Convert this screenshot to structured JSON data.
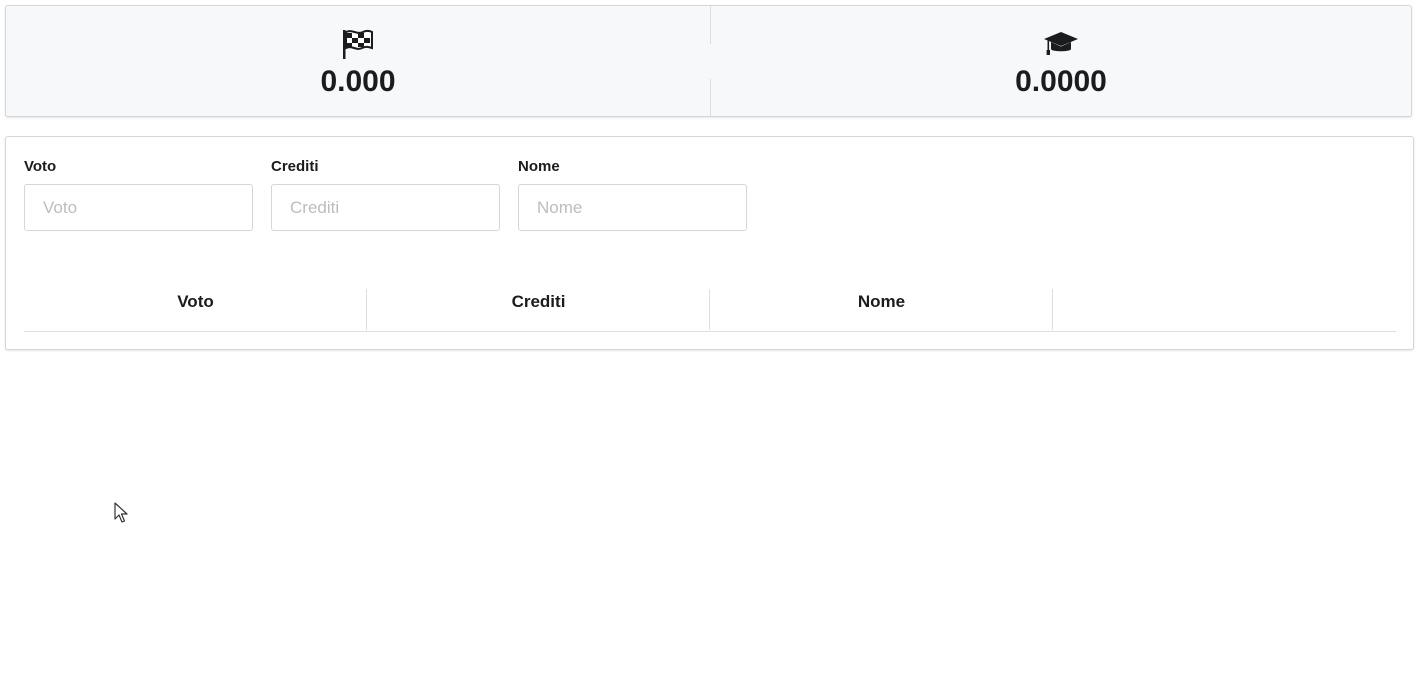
{
  "stats": {
    "left": {
      "icon": "checkered-flag-icon",
      "value": "0.000"
    },
    "right": {
      "icon": "graduation-cap-icon",
      "value": "0.0000"
    }
  },
  "form": {
    "fields": [
      {
        "label": "Voto",
        "placeholder": "Voto",
        "value": ""
      },
      {
        "label": "Crediti",
        "placeholder": "Crediti",
        "value": ""
      },
      {
        "label": "Nome",
        "placeholder": "Nome",
        "value": ""
      }
    ]
  },
  "table": {
    "headers": [
      "Voto",
      "Crediti",
      "Nome",
      ""
    ],
    "rows": []
  }
}
